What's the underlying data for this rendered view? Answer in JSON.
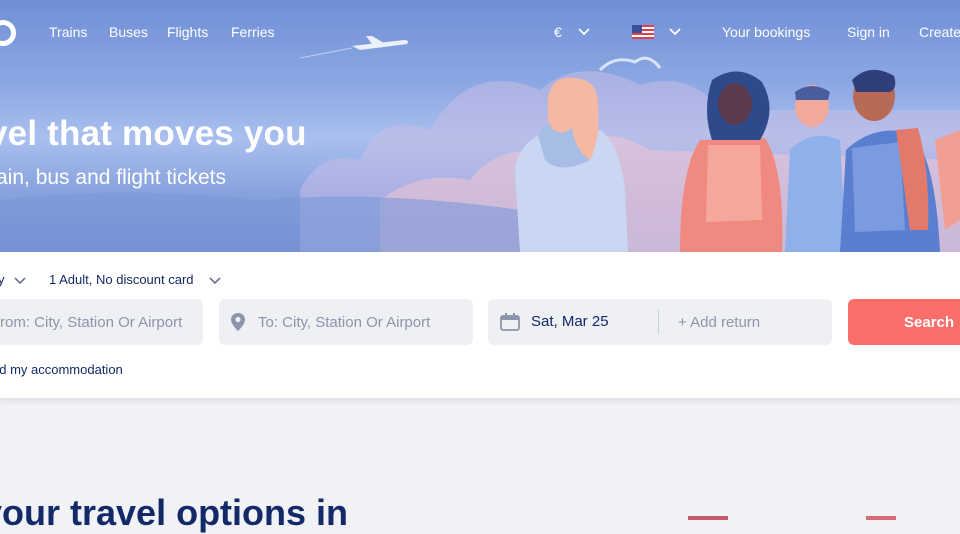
{
  "nav": {
    "links": [
      "Trains",
      "Buses",
      "Flights",
      "Ferries"
    ],
    "currency": "€",
    "your_bookings": "Your bookings",
    "sign_in": "Sign in",
    "create": "Create"
  },
  "hero": {
    "title": "vel that moves you",
    "subtitle": "ain, bus and flight tickets"
  },
  "search": {
    "trip_type": "y",
    "passengers": "1 Adult, No discount card",
    "from_placeholder": "rom: City, Station Or Airport",
    "to_placeholder": "To: City, Station Or Airport",
    "date": "Sat, Mar 25",
    "add_return": "+ Add return",
    "button": "Search",
    "accommodation": "nd my accommodation"
  },
  "section": {
    "title": "your travel options in"
  },
  "colors": {
    "brand": "#132968",
    "accent": "#fc6e6a",
    "hero_bg": "#8ea9e4"
  }
}
